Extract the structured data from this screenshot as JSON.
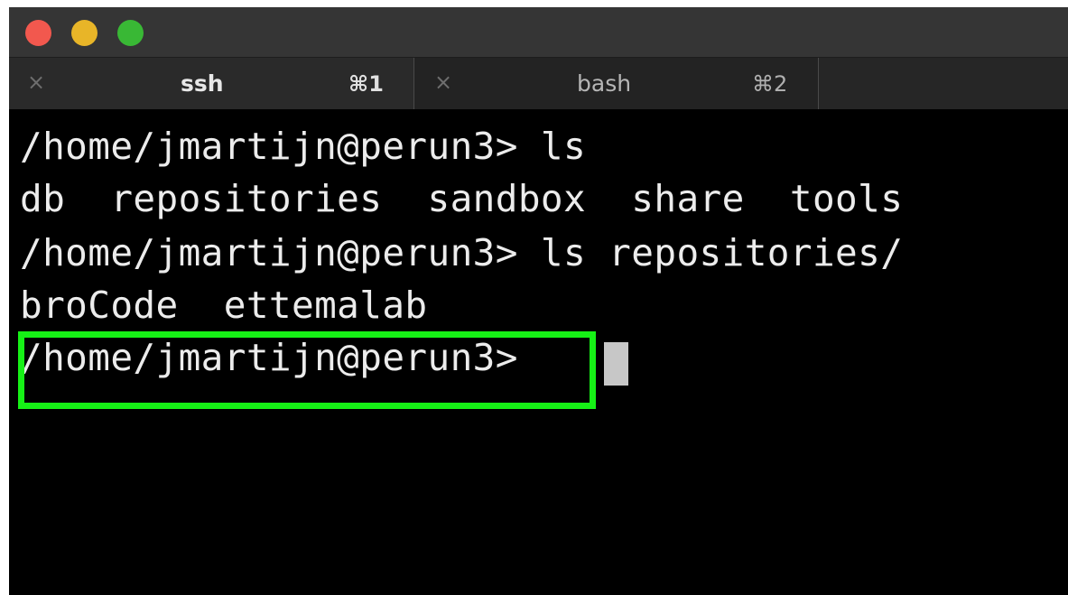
{
  "window": {
    "traffic_lights": {
      "close_color": "#f2584e",
      "minimize_color": "#e8b528",
      "zoom_color": "#39b835"
    }
  },
  "tabs": [
    {
      "close_glyph": "×",
      "title": "ssh",
      "shortcut": "⌘1",
      "active": true
    },
    {
      "close_glyph": "×",
      "title": "bash",
      "shortcut": "⌘2",
      "active": false
    }
  ],
  "terminal": {
    "lines": [
      "/home/jmartijn@perun3> ls",
      "db  repositories  sandbox  share  tools",
      "/home/jmartijn@perun3> ls repositories/",
      "broCode  ettemalab",
      "/home/jmartijn@perun3>"
    ],
    "cursor_color": "#c7c7c7",
    "text_color": "#ececec",
    "background_color": "#000000"
  },
  "annotation": {
    "highlight_color": "#16f116"
  }
}
